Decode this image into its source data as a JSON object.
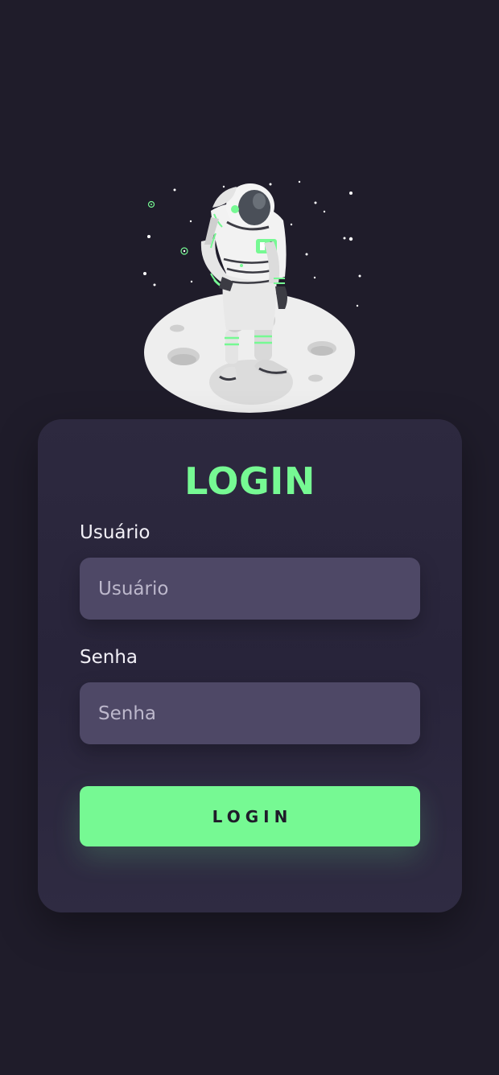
{
  "login": {
    "title": "LOGIN",
    "username_label": "Usuário",
    "username_placeholder": "Usuário",
    "password_label": "Senha",
    "password_placeholder": "Senha",
    "submit_label": "LOGIN"
  },
  "illustration": {
    "icon": "astronaut-on-moon-illustration"
  },
  "colors": {
    "background": "#1f1c2a",
    "card": "#2b2740",
    "field": "#4e4866",
    "accent": "#76f993"
  }
}
